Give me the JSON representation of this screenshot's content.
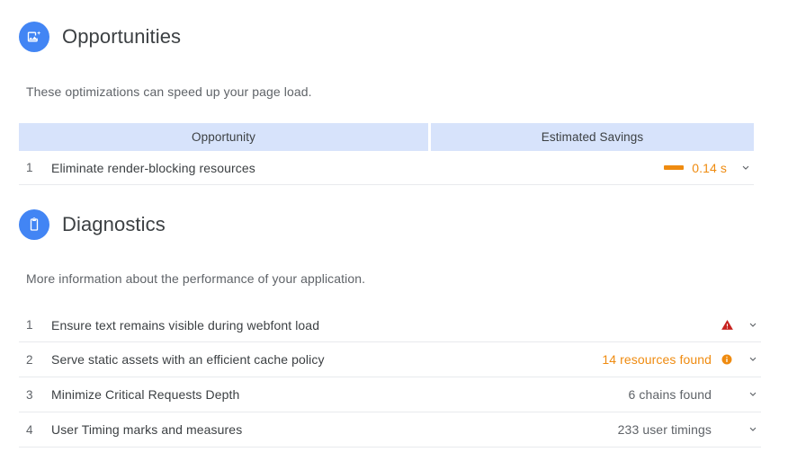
{
  "opportunities": {
    "icon": "image-sparkle-icon",
    "title": "Opportunities",
    "description": "These optimizations can speed up your page load.",
    "table": {
      "headers": {
        "opportunity": "Opportunity",
        "savings": "Estimated Savings"
      },
      "rows": [
        {
          "index": "1",
          "title": "Eliminate render-blocking resources",
          "savings_value": "0.14 s",
          "savings_bar_color": "#ef8b10",
          "chevron": "chevron-down-icon"
        }
      ]
    }
  },
  "diagnostics": {
    "icon": "clipboard-icon",
    "title": "Diagnostics",
    "description": "More information about the performance of your application.",
    "rows": [
      {
        "index": "1",
        "title": "Ensure text remains visible during webfont load",
        "value": "",
        "value_color": "#5f6368",
        "status_icon": "warning-triangle-icon",
        "status_color": "#c7221f",
        "chevron": "chevron-down-icon"
      },
      {
        "index": "2",
        "title": "Serve static assets with an efficient cache policy",
        "value": "14 resources found",
        "value_color": "#ef8b10",
        "status_icon": "info-circle-icon",
        "status_color": "#ef8b10",
        "chevron": "chevron-down-icon"
      },
      {
        "index": "3",
        "title": "Minimize Critical Requests Depth",
        "value": "6 chains found",
        "value_color": "#5f6368",
        "status_icon": "",
        "status_color": "",
        "chevron": "chevron-down-icon"
      },
      {
        "index": "4",
        "title": "User Timing marks and measures",
        "value": "233 user timings",
        "value_color": "#5f6368",
        "status_icon": "",
        "status_color": "",
        "chevron": "chevron-down-icon"
      }
    ]
  },
  "colors": {
    "accent_blue": "#4285f4",
    "header_blue": "#d7e3fb",
    "warn_orange": "#ef8b10",
    "error_red": "#c7221f",
    "text_primary": "#3c4043",
    "text_secondary": "#5f6368",
    "divider": "#e8eaed"
  }
}
